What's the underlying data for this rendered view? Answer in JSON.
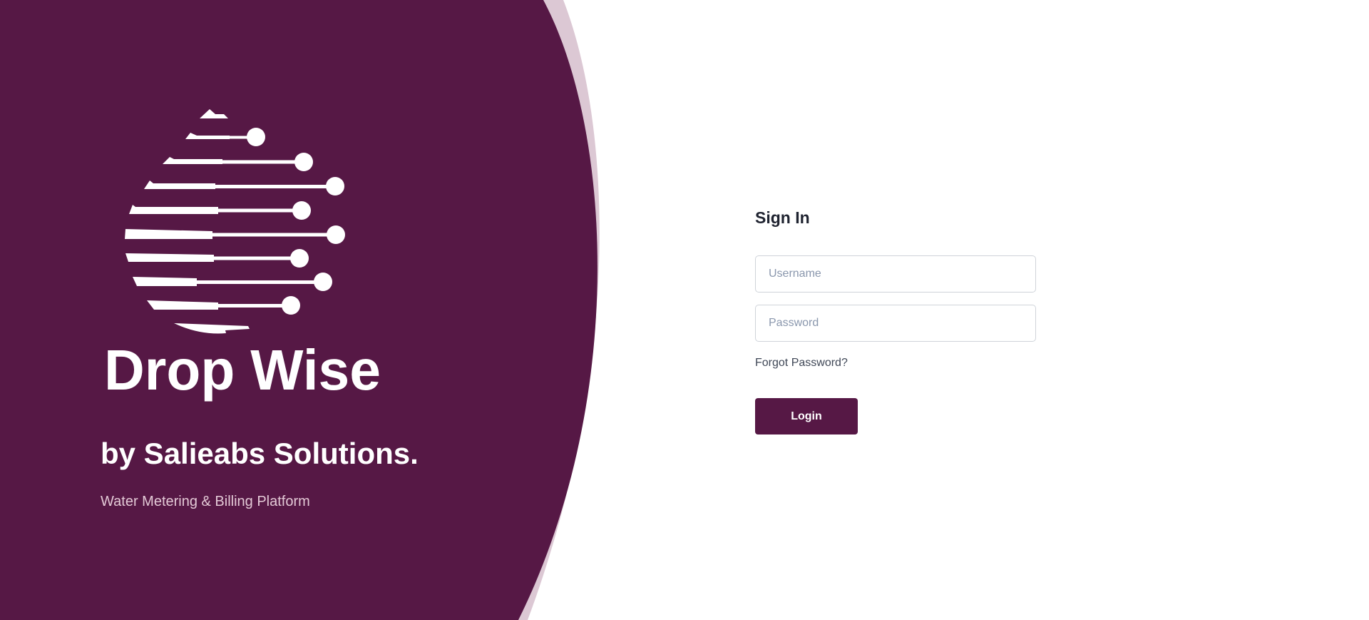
{
  "brand": {
    "name": "Drop Wise",
    "by_line": "by Salieabs Solutions.",
    "tagline": "Water Metering & Billing Platform",
    "logo_icon": "water-drop-circuit-icon"
  },
  "login": {
    "title": "Sign In",
    "username_placeholder": "Username",
    "username_value": "",
    "password_placeholder": "Password",
    "password_value": "",
    "forgot_label": "Forgot Password?",
    "submit_label": "Login"
  },
  "colors": {
    "primary": "#561845",
    "primary_light": "#dcc8d4",
    "background": "#ffffff",
    "title_text": "#1f2330",
    "placeholder_text": "#8a97ad"
  }
}
